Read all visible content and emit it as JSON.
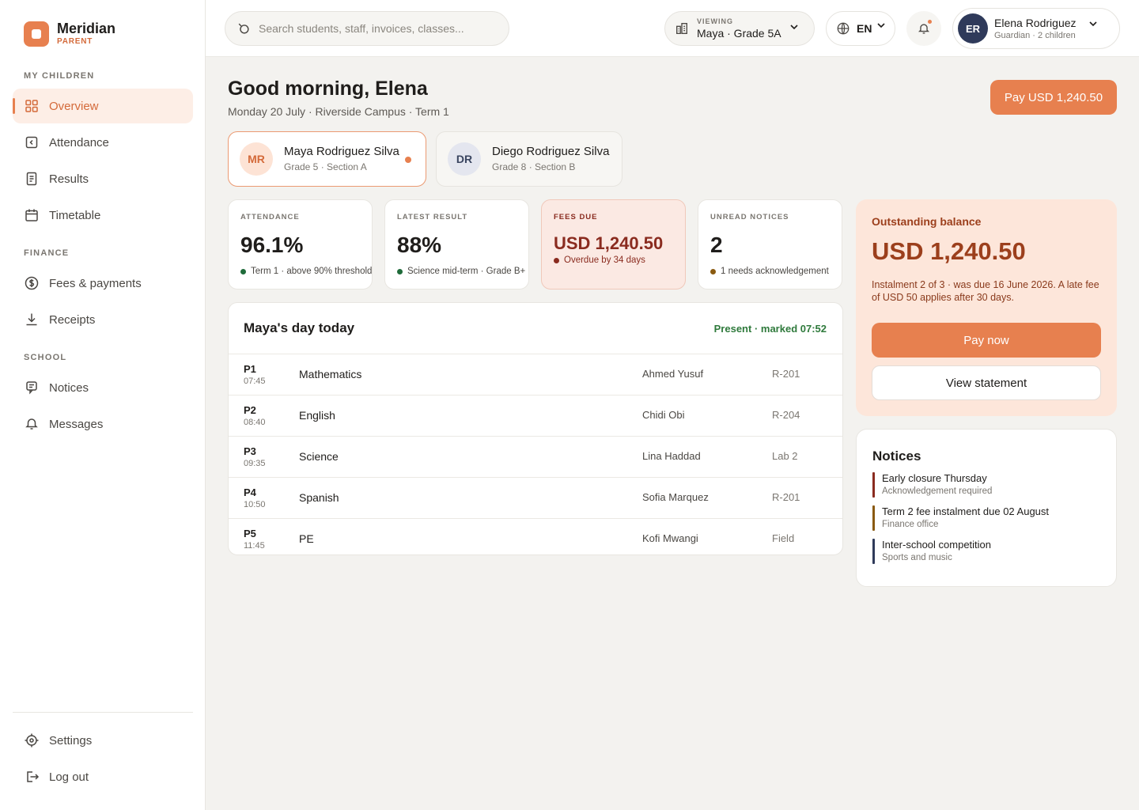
{
  "brand": {
    "name": "Meridian",
    "sub": "PARENT"
  },
  "sidebar": {
    "sections": [
      {
        "title": "MY CHILDREN",
        "items": [
          {
            "label": "Overview",
            "icon": "grid-icon",
            "active": true
          },
          {
            "label": "Attendance",
            "icon": "attendance-icon"
          },
          {
            "label": "Results",
            "icon": "document-icon"
          },
          {
            "label": "Timetable",
            "icon": "calendar-icon"
          }
        ]
      },
      {
        "title": "FINANCE",
        "items": [
          {
            "label": "Fees & payments",
            "icon": "coin-icon"
          },
          {
            "label": "Receipts",
            "icon": "download-icon"
          }
        ]
      },
      {
        "title": "SCHOOL",
        "items": [
          {
            "label": "Notices",
            "icon": "notice-icon"
          },
          {
            "label": "Messages",
            "icon": "message-icon"
          }
        ]
      }
    ],
    "footer": [
      {
        "label": "Settings",
        "icon": "gear-icon"
      },
      {
        "label": "Log out",
        "icon": "logout-icon"
      }
    ]
  },
  "topbar": {
    "search_placeholder": "Search students, staff, invoices, classes...",
    "viewing_label": "VIEWING",
    "viewing_value": "Maya · Grade 5A",
    "language": "EN",
    "user": {
      "initials": "ER",
      "name": "Elena Rodriguez",
      "sub": "Guardian · 2 children"
    }
  },
  "header": {
    "greeting": "Good morning, Elena",
    "subtitle": "Monday 20 July · Riverside Campus · Term 1",
    "pay_button": "Pay USD 1,240.50"
  },
  "children": [
    {
      "initials": "MR",
      "name": "Maya Rodriguez Silva",
      "sub": "Grade 5 · Section A"
    },
    {
      "initials": "DR",
      "name": "Diego Rodriguez Silva",
      "sub": "Grade 8 · Section B"
    }
  ],
  "stats": [
    {
      "label": "ATTENDANCE",
      "value": "96.1%",
      "note": "Term 1 · above 90% threshold",
      "dot": "#1f6b3a"
    },
    {
      "label": "LATEST RESULT",
      "value": "88%",
      "note": "Science mid-term · Grade B+",
      "dot": "#1f6b3a"
    },
    {
      "label": "FEES DUE",
      "value": "USD 1,240.50",
      "note": "Overdue by 34 days",
      "dot": "#8a2b1f"
    },
    {
      "label": "UNREAD NOTICES",
      "value": "2",
      "note": "1 needs acknowledgement",
      "dot": "#8a5a10"
    }
  ],
  "day": {
    "title": "Maya's day today",
    "status": "Present · marked 07:52",
    "periods": [
      {
        "period": "P1",
        "time": "07:45",
        "subject": "Mathematics",
        "teacher": "Ahmed Yusuf",
        "room": "R-201"
      },
      {
        "period": "P2",
        "time": "08:40",
        "subject": "English",
        "teacher": "Chidi Obi",
        "room": "R-204"
      },
      {
        "period": "P3",
        "time": "09:35",
        "subject": "Science",
        "teacher": "Lina Haddad",
        "room": "Lab 2"
      },
      {
        "period": "P4",
        "time": "10:50",
        "subject": "Spanish",
        "teacher": "Sofia Marquez",
        "room": "R-201"
      },
      {
        "period": "P5",
        "time": "11:45",
        "subject": "PE",
        "teacher": "Kofi Mwangi",
        "room": "Field"
      }
    ]
  },
  "balance": {
    "label": "Outstanding balance",
    "value": "USD 1,240.50",
    "description": "Instalment 2 of 3 · was due 16 June 2026. A late fee of USD 50 applies after 30 days.",
    "pay_now": "Pay now",
    "view_statement": "View statement"
  },
  "notices": {
    "title": "Notices",
    "items": [
      {
        "title": "Early closure Thursday",
        "sub": "Acknowledgement required",
        "color": "#8a2b1f"
      },
      {
        "title": "Term 2 fee instalment due 02 August",
        "sub": "Finance office",
        "color": "#8a5a10"
      },
      {
        "title": "Inter-school competition",
        "sub": "Sports and music",
        "color": "#2f3a5a"
      }
    ]
  },
  "colors": {
    "accent": "#e7804f",
    "accent_soft": "#fdeee6",
    "danger": "#8a2b1f",
    "success": "#2f7a3c"
  }
}
